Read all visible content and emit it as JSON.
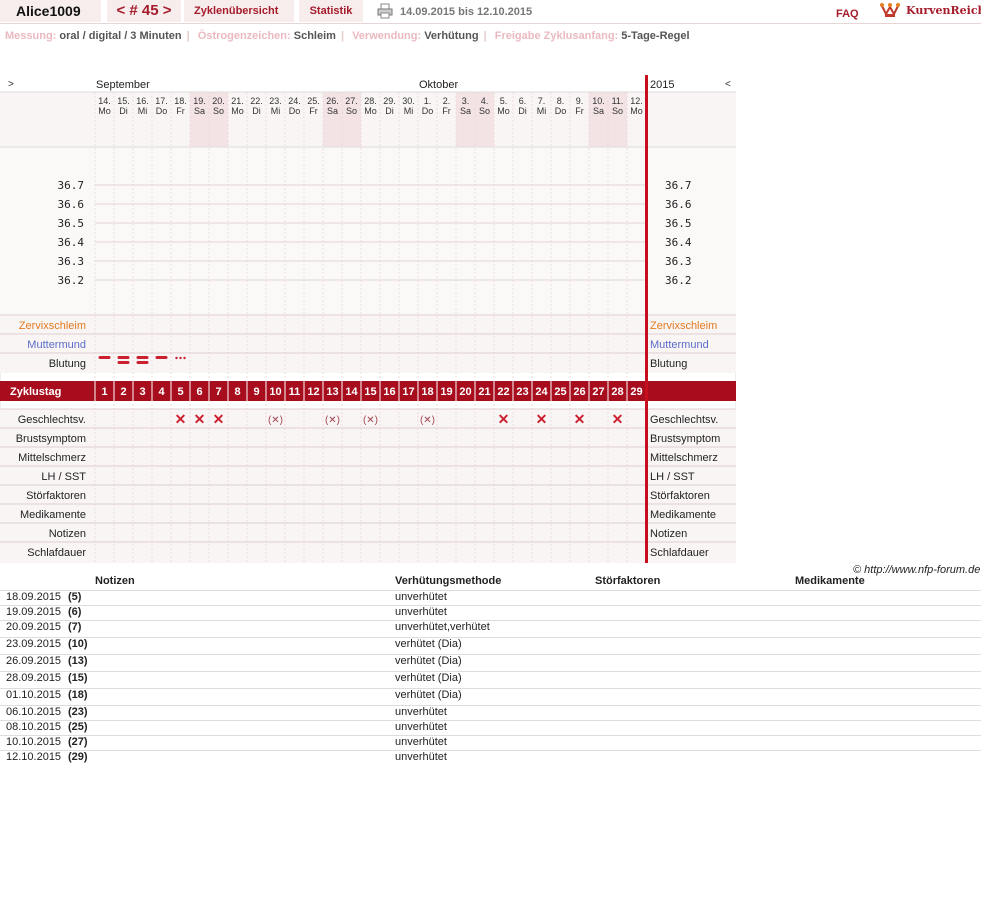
{
  "header": {
    "username": "Alice1009",
    "cycle_nav": "< # 45 >",
    "overview_label": "Zyklenübersicht",
    "stats_label": "Statistik",
    "date_range": "14.09.2015 bis 12.10.2015",
    "faq_label": "FAQ",
    "logo_text": "KurvenReich"
  },
  "info": {
    "measure_label": "Messung:",
    "measure_value": "oral / digital / 3 Minuten",
    "estrogen_label": "Östrogenzeichen:",
    "estrogen_value": "Schleim",
    "usage_label": "Verwendung:",
    "usage_value": "Verhütung",
    "release_label": "Freigabe Zyklusanfang:",
    "release_value": "5-Tage-Regel"
  },
  "chart": {
    "nav_left": ">",
    "nav_right": "<",
    "month1": "September",
    "month2": "Oktober",
    "year": "2015",
    "days": [
      {
        "d": "14.",
        "w": "Mo"
      },
      {
        "d": "15.",
        "w": "Di"
      },
      {
        "d": "16.",
        "w": "Mi"
      },
      {
        "d": "17.",
        "w": "Do"
      },
      {
        "d": "18.",
        "w": "Fr"
      },
      {
        "d": "19.",
        "w": "Sa",
        "weekend": true
      },
      {
        "d": "20.",
        "w": "So",
        "weekend": true
      },
      {
        "d": "21.",
        "w": "Mo"
      },
      {
        "d": "22.",
        "w": "Di"
      },
      {
        "d": "23.",
        "w": "Mi"
      },
      {
        "d": "24.",
        "w": "Do"
      },
      {
        "d": "25.",
        "w": "Fr"
      },
      {
        "d": "26.",
        "w": "Sa",
        "weekend": true
      },
      {
        "d": "27.",
        "w": "So",
        "weekend": true
      },
      {
        "d": "28.",
        "w": "Mo"
      },
      {
        "d": "29.",
        "w": "Di"
      },
      {
        "d": "30.",
        "w": "Mi"
      },
      {
        "d": "1.",
        "w": "Do"
      },
      {
        "d": "2.",
        "w": "Fr"
      },
      {
        "d": "3.",
        "w": "Sa",
        "weekend": true
      },
      {
        "d": "4.",
        "w": "So",
        "weekend": true
      },
      {
        "d": "5.",
        "w": "Mo"
      },
      {
        "d": "6.",
        "w": "Di"
      },
      {
        "d": "7.",
        "w": "Mi"
      },
      {
        "d": "8.",
        "w": "Do"
      },
      {
        "d": "9.",
        "w": "Fr"
      },
      {
        "d": "10.",
        "w": "Sa",
        "weekend": true
      },
      {
        "d": "11.",
        "w": "So",
        "weekend": true
      },
      {
        "d": "12.",
        "w": "Mo"
      }
    ],
    "temperature_ticks": [
      "36.7",
      "36.6",
      "36.5",
      "36.4",
      "36.3",
      "36.2"
    ],
    "row_labels": {
      "cervix": "Zervixschleim",
      "cervix_pos": "Muttermund",
      "bleeding": "Blutung",
      "cycle_day": "Zyklustag",
      "intercourse": "Geschlechtsv.",
      "breast": "Brustsymptom",
      "midpain": "Mittelschmerz",
      "lh": "LH / SST",
      "disturb": "Störfaktoren",
      "meds": "Medikamente",
      "notes": "Notizen",
      "sleep": "Schlafdauer"
    },
    "bleeding": {
      "1": "heavy",
      "2": "heavy2",
      "3": "heavy2",
      "4": "medium",
      "5": "spotting"
    },
    "intercourse": {
      "5": "x",
      "6": "x",
      "7": "x",
      "10": "(x)",
      "13": "(x)",
      "15": "(x)",
      "18": "(x)",
      "22": "x",
      "24": "x",
      "26": "x",
      "28": "x"
    },
    "cycle_day_count": 29
  },
  "copyright": "© http://www.nfp-forum.de",
  "notes_table": {
    "headers": {
      "notes": "Notizen",
      "method": "Verhütungsmethode",
      "disturb": "Störfaktoren",
      "meds": "Medikamente"
    },
    "rows": [
      {
        "date": "18.09.2015",
        "day": "(5)",
        "method": "unverhütet"
      },
      {
        "date": "19.09.2015",
        "day": "(6)",
        "method": "unverhütet"
      },
      {
        "date": "20.09.2015",
        "day": "(7)",
        "method": "unverhütet,verhütet"
      },
      {
        "date": "23.09.2015",
        "day": "(10)",
        "method": "verhütet (Dia)"
      },
      {
        "date": "26.09.2015",
        "day": "(13)",
        "method": "verhütet (Dia)"
      },
      {
        "date": "28.09.2015",
        "day": "(15)",
        "method": "verhütet (Dia)"
      },
      {
        "date": "01.10.2015",
        "day": "(18)",
        "method": "verhütet (Dia)"
      },
      {
        "date": "06.10.2015",
        "day": "(23)",
        "method": "unverhütet"
      },
      {
        "date": "08.10.2015",
        "day": "(25)",
        "method": "unverhütet"
      },
      {
        "date": "10.10.2015",
        "day": "(27)",
        "method": "unverhütet"
      },
      {
        "date": "12.10.2015",
        "day": "(29)",
        "method": "unverhütet"
      }
    ]
  },
  "colors": {
    "accent": "#a51c2c",
    "weekend": "#f3e3e5",
    "grid": "#ead7d9",
    "cervix": "#e07a1f",
    "cervix_pos": "#5a6cc8"
  }
}
